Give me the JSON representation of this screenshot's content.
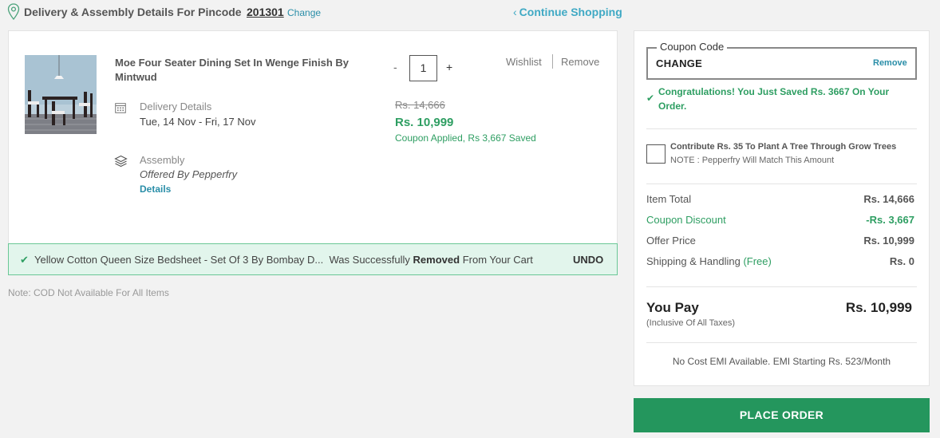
{
  "header": {
    "title": "Delivery & Assembly Details For Pincode",
    "pincode": "201301",
    "change_label": "Change",
    "continue_shopping": "Continue Shopping"
  },
  "cart_item": {
    "name": "Moe Four Seater Dining Set In Wenge Finish By Mintwud",
    "quantity": "1",
    "qty_minus": "-",
    "qty_plus": "+",
    "wishlist_label": "Wishlist",
    "remove_label": "Remove",
    "delivery_label": "Delivery Details",
    "delivery_dates": "Tue, 14 Nov - Fri, 17 Nov",
    "price_original": "Rs. 14,666",
    "price_offer": "Rs. 10,999",
    "coupon_note": "Coupon Applied, Rs 3,667 Saved",
    "assembly_label": "Assembly",
    "assembly_offered": "Offered By Pepperfry",
    "assembly_details_link": "Details"
  },
  "removed_banner": {
    "item_name": "Yellow Cotton Queen Size Bedsheet - Set Of 3 By Bombay D...",
    "was_text": "Was Successfully",
    "removed_word": "Removed",
    "from_text": "From Your Cart",
    "undo_label": "UNDO"
  },
  "cod_note": "Note: COD Not Available For All Items",
  "summary": {
    "coupon_legend": "Coupon Code",
    "coupon_value": "CHANGE",
    "coupon_remove": "Remove",
    "congrats": "Congratulations! You Just Saved Rs. 3667 On Your Order.",
    "tree_text": "Contribute Rs. 35 To Plant A Tree Through Grow Trees",
    "tree_note": "NOTE : Pepperfry Will Match This Amount",
    "rows": [
      {
        "label": "Item Total",
        "value": "Rs. 14,666"
      },
      {
        "label": "Coupon Discount",
        "value": "-Rs. 3,667"
      },
      {
        "label": "Offer Price",
        "value": "Rs. 10,999"
      },
      {
        "label": "Shipping & Handling",
        "value": "Rs. 0"
      }
    ],
    "shipping_free": "(Free)",
    "you_pay_label": "You Pay",
    "inclusive_taxes": "(Inclusive Of All Taxes)",
    "you_pay_value": "Rs. 10,999",
    "emi_text": "No Cost EMI Available. EMI Starting Rs. 523/Month",
    "place_order_label": "PLACE ORDER"
  },
  "colors": {
    "accent_green": "#2e9e62",
    "link_blue": "#2a8ea8",
    "place_order_bg": "#24965d",
    "banner_bg": "#e2f5ec"
  },
  "icons": [
    "location-pin-icon",
    "chevron-left-icon",
    "calendar-icon",
    "layers-icon",
    "check-icon"
  ]
}
